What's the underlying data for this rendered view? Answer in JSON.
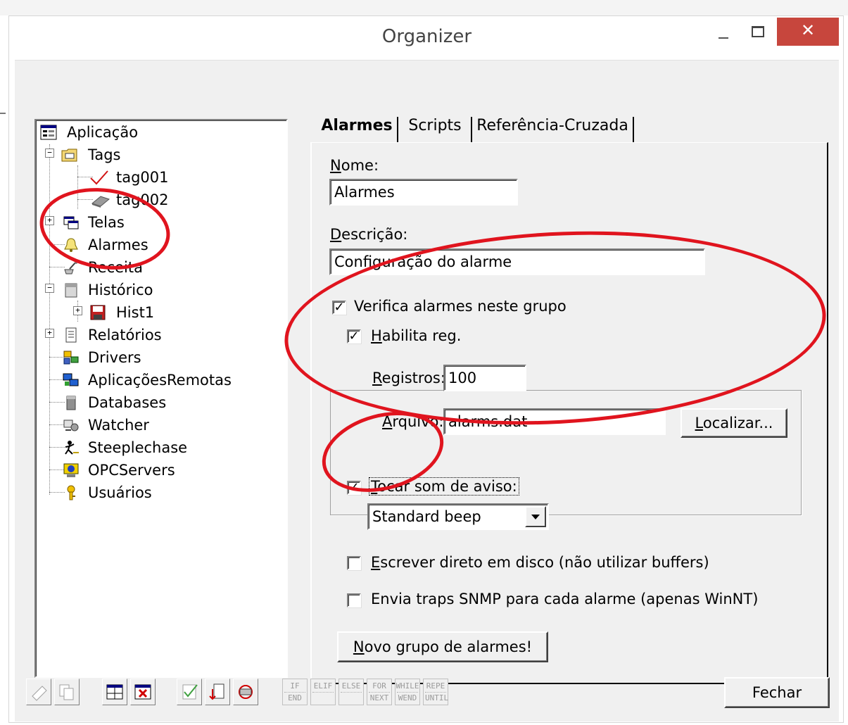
{
  "window": {
    "title": "Organizer",
    "minimize_symbol": "—",
    "close_symbol": "✕"
  },
  "tree": {
    "items": [
      {
        "label": "Aplicação",
        "icon": "application-icon"
      },
      {
        "label": "Tags",
        "icon": "tags-folder-icon"
      },
      {
        "label": "tag001",
        "icon": "tag-check-icon"
      },
      {
        "label": "tag002",
        "icon": "tag-eraser-icon"
      },
      {
        "label": "Telas",
        "icon": "screens-icon"
      },
      {
        "label": "Alarmes",
        "icon": "alarm-bell-icon"
      },
      {
        "label": "Receita",
        "icon": "recipe-icon"
      },
      {
        "label": "Histórico",
        "icon": "history-icon"
      },
      {
        "label": "Hist1",
        "icon": "disk-icon"
      },
      {
        "label": "Relatórios",
        "icon": "reports-icon"
      },
      {
        "label": "Drivers",
        "icon": "drivers-icon"
      },
      {
        "label": "AplicaçõesRemotas",
        "icon": "remote-apps-icon"
      },
      {
        "label": "Databases",
        "icon": "database-icon"
      },
      {
        "label": "Watcher",
        "icon": "watcher-icon"
      },
      {
        "label": "Steeplechase",
        "icon": "steeplechase-icon"
      },
      {
        "label": "OPCServers",
        "icon": "opc-server-icon"
      },
      {
        "label": "Usuários",
        "icon": "users-key-icon"
      }
    ],
    "expander_plus": "+",
    "expander_minus": "−"
  },
  "tabs": [
    {
      "label": "Alarmes",
      "active": true
    },
    {
      "label": "Scripts",
      "active": false
    },
    {
      "label": "Referência-Cruzada",
      "active": false
    }
  ],
  "form": {
    "nome_label_acc": "N",
    "nome_label_rest": "ome:",
    "nome_value": "Alarmes",
    "descricao_label_acc": "D",
    "descricao_label_rest": "escrição:",
    "descricao_value": "Configuração do alarme",
    "verifica_label": "Verifica alarmes neste grupo",
    "verifica_checked": true,
    "habilita_label_acc": "H",
    "habilita_label_rest": "abilita reg.",
    "habilita_checked": true,
    "registros_label_acc": "R",
    "registros_label_rest": "egistros:",
    "registros_value": "100",
    "arquivo_label_acc": "A",
    "arquivo_label_rest": "rquivo:",
    "arquivo_value": "alarms.dat",
    "localizar_acc": "L",
    "localizar_rest": "ocalizar...",
    "tocar_label_acc": "T",
    "tocar_label_rest": "ocar som de aviso:",
    "tocar_checked": true,
    "sound_selected": "Standard beep",
    "escrever_label_acc": "E",
    "escrever_label_rest": "screver direto em disco (não utilizar buffers)",
    "escrever_checked": false,
    "envia_label": "Envia traps SNMP para cada alarme (apenas WinNT)",
    "envia_checked": false,
    "novo_grupo_acc": "N",
    "novo_grupo_rest": "ovo grupo de alarmes!",
    "check_mark": "✓"
  },
  "footer": {
    "keyword_buttons": [
      {
        "top": "IF",
        "bottom": "END"
      },
      {
        "top": "ELIF",
        "bottom": ""
      },
      {
        "top": "ELSE",
        "bottom": ""
      },
      {
        "top": "FOR",
        "bottom": "NEXT"
      },
      {
        "top": "WHILE",
        "bottom": "WEND"
      },
      {
        "top": "REPE",
        "bottom": "UNTIL"
      }
    ],
    "close_button": "Fechar"
  },
  "colors": {
    "annotation_red": "#e0141e",
    "close_button_red": "#c7463d"
  }
}
